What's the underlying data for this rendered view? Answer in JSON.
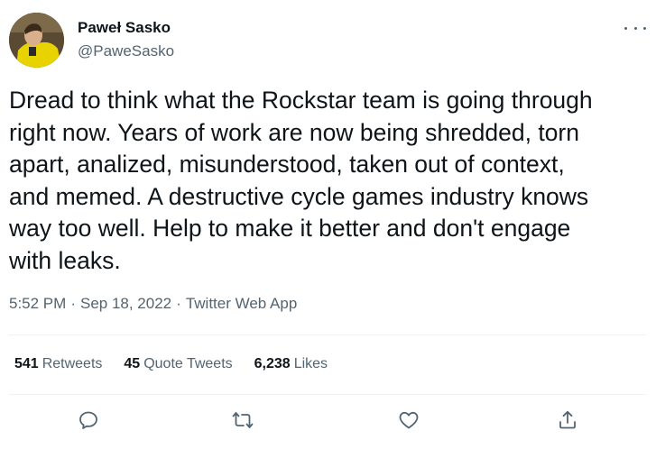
{
  "author": {
    "display_name": "Paweł Sasko",
    "handle": "@PaweSasko"
  },
  "tweet": {
    "text": "Dread to think what the Rockstar team is going through\nright now. Years of work are now being shredded, torn\napart, analized, misunderstood, taken out of context,\nand memed. A destructive cycle games industry knows\nway too well. Help to make it better and don't engage\nwith leaks.",
    "time": "5:52 PM",
    "separator": "·",
    "date": "Sep 18, 2022",
    "source": "Twitter Web App"
  },
  "stats": {
    "retweets_count": "541",
    "retweets_label": "Retweets",
    "quotes_count": "45",
    "quotes_label": "Quote Tweets",
    "likes_count": "6,238",
    "likes_label": "Likes"
  },
  "icons": {
    "more": "more-horizontal-icon",
    "reply": "reply-icon",
    "retweet": "retweet-icon",
    "like": "like-icon",
    "share": "share-icon"
  },
  "colors": {
    "text_primary": "#0f1419",
    "text_secondary": "#536471",
    "divider": "#eff3f4",
    "avatar_shirt": "#e8d200"
  }
}
